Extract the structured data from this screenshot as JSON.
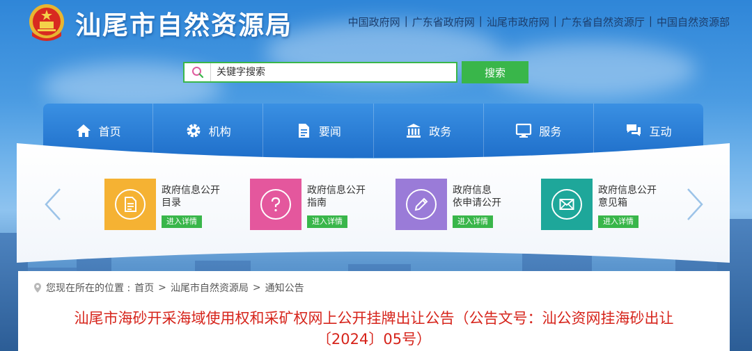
{
  "site": {
    "title": "汕尾市自然资源局"
  },
  "top_links": [
    "中国政府网",
    "广东省政府网",
    "汕尾市政府网",
    "广东省自然资源厅",
    "中国自然资源部"
  ],
  "search": {
    "placeholder": "关键字搜索",
    "button": "搜索"
  },
  "nav": [
    {
      "label": "首页",
      "icon": "home-icon"
    },
    {
      "label": "机构",
      "icon": "gear-icon"
    },
    {
      "label": "要闻",
      "icon": "document-icon"
    },
    {
      "label": "政务",
      "icon": "government-building-icon"
    },
    {
      "label": "服务",
      "icon": "monitor-icon"
    },
    {
      "label": "互动",
      "icon": "chat-icon"
    }
  ],
  "cards": [
    {
      "line1": "政府信息公开",
      "line2": "目录",
      "more": "进入详情",
      "color": "#f5b233",
      "icon": "document-list-icon"
    },
    {
      "line1": "政府信息公开",
      "line2": "指南",
      "more": "进入详情",
      "color": "#e4579d",
      "icon": "question-icon"
    },
    {
      "line1": "政府信息",
      "line2": "依申请公开",
      "more": "进入详情",
      "color": "#9a7bd8",
      "icon": "pen-icon"
    },
    {
      "line1": "政府信息公开",
      "line2": "意见箱",
      "more": "进入详情",
      "color": "#1ea79a",
      "icon": "envelope-icon"
    }
  ],
  "breadcrumb": {
    "prefix": "您现在所在的位置 : ",
    "items": [
      "首页",
      "汕尾市自然资源局",
      "通知公告"
    ]
  },
  "article": {
    "title": "汕尾市海砂开采海域使用权和采矿权网上公开挂牌出让公告（公告文号：汕公资网挂海砂出让〔2024〕05号）"
  },
  "colors": {
    "accent_green": "#39b64a",
    "nav_blue": "#2a7fd8",
    "title_red": "#d6241b"
  }
}
